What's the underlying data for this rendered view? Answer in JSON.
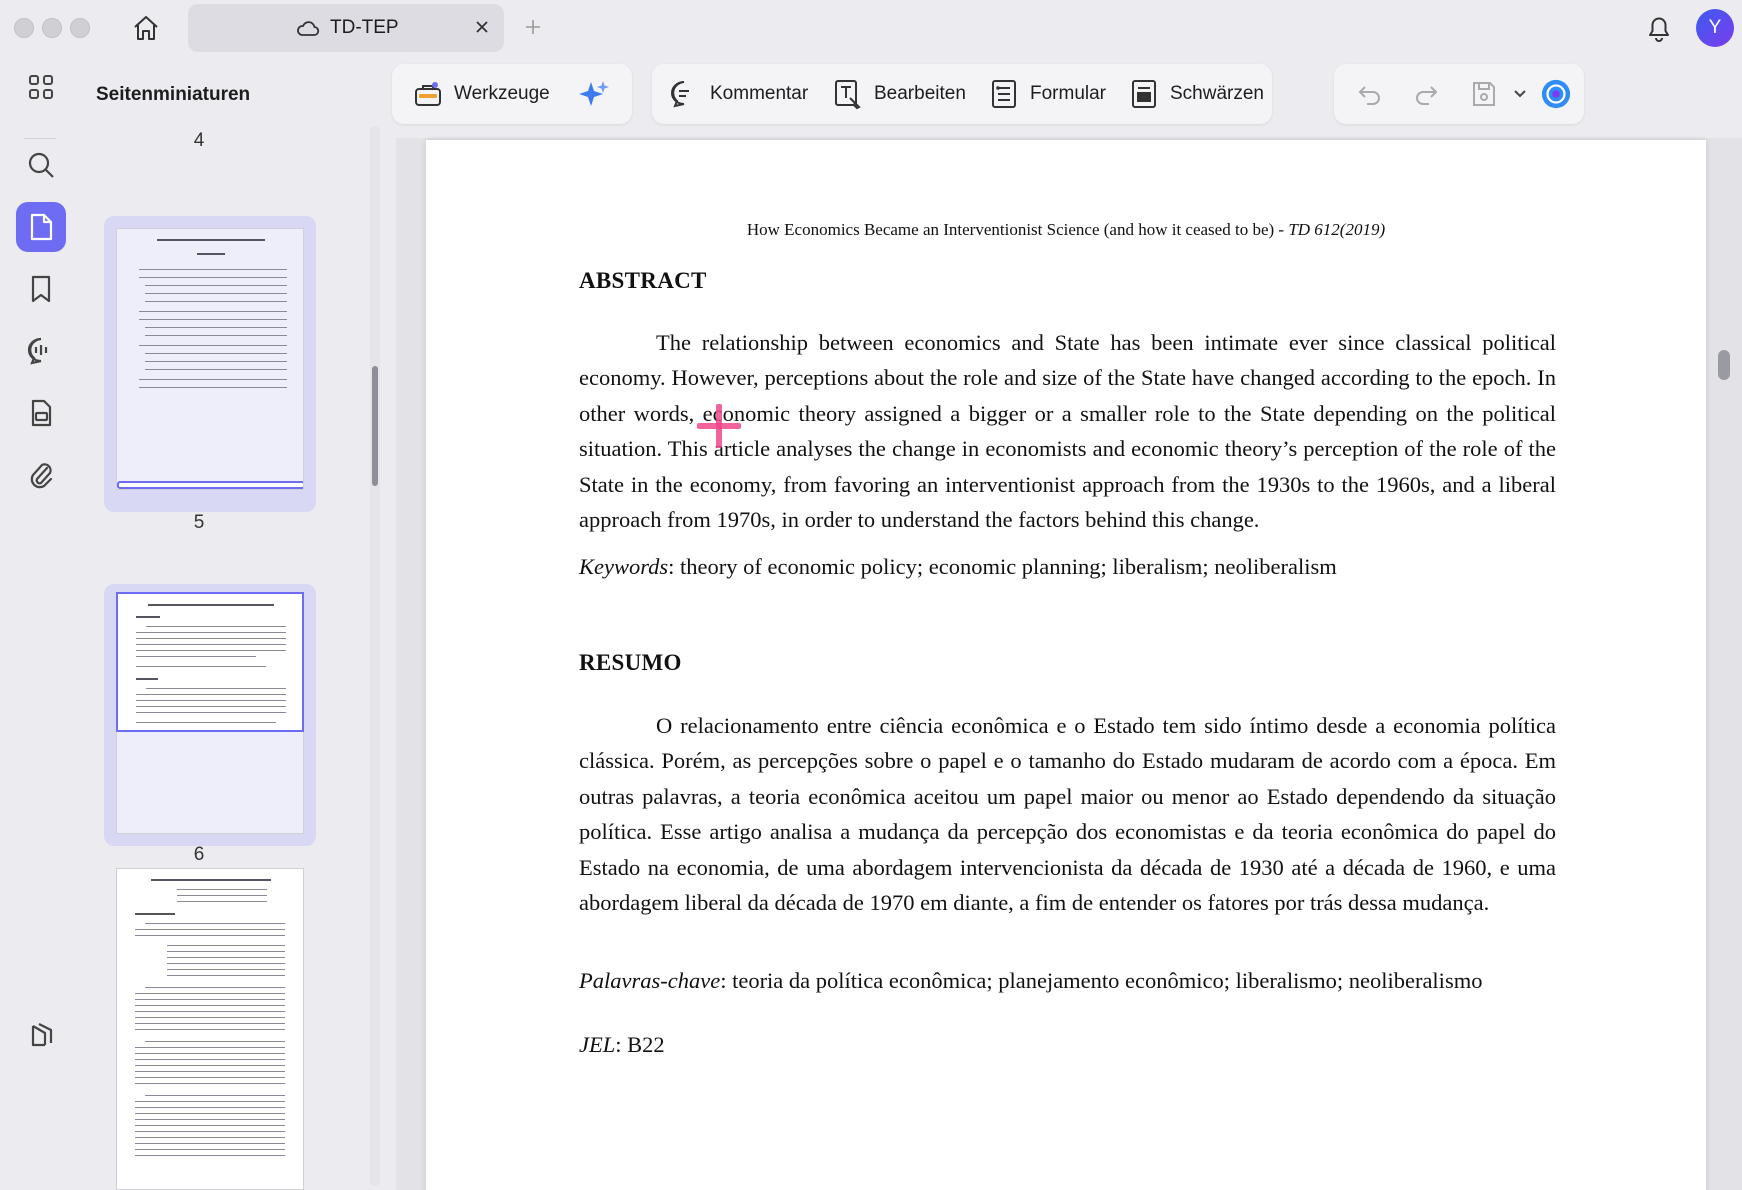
{
  "window": {
    "tab_title": "TD-TEP",
    "user_initial": "Y"
  },
  "sidebar": {
    "panel_title": "Seitenminiaturen",
    "page_numbers": [
      "4",
      "5",
      "6"
    ]
  },
  "toolbar": {
    "tools_label": "Werkzeuge",
    "comment_label": "Kommentar",
    "edit_label": "Bearbeiten",
    "form_label": "Formular",
    "redact_label": "Schwärzen"
  },
  "document": {
    "running_head": "How Economics Became an Interventionist Science (and how it ceased to be) - ",
    "running_head_italic": "TD 612(2019)",
    "abstract_heading": "ABSTRACT",
    "abstract_text": "The relationship between economics and State has been intimate ever since classical political economy. However, perceptions about the role and size of the State have changed according to the epoch. In other words, economic theory assigned a bigger or a smaller role to the State depending on the political situation. This article analyses the change in economists and economic theory’s perception of the role of the State in the economy, from favoring an interventionist approach from the 1930s to the 1960s, and a liberal approach from 1970s, in order to understand the factors behind this change.",
    "keywords_label": "Keywords",
    "keywords_text": ": theory of economic policy; economic planning; liberalism; neoliberalism",
    "resumo_heading": "RESUMO",
    "resumo_text": "O relacionamento entre ciência econômica e o Estado tem sido íntimo desde a economia política clássica. Porém, as percepções sobre o papel e o tamanho do Estado mudaram de acordo com a época. Em outras palavras, a teoria econômica aceitou um papel maior ou menor ao Estado dependendo da situação política. Esse artigo analisa a mudança da percepção dos economistas e da teoria econômica do papel do Estado na economia, de uma abordagem intervencionista da década de 1930 até a década de 1960, e uma abordagem liberal da década de 1970 em diante, a fim de entender os fatores por trás dessa mudança.",
    "palavras_label": "Palavras-chave",
    "palavras_text": ": teoria da política econômica; planejamento econômico; liberalismo; neoliberalismo",
    "jel_label": "JEL",
    "jel_text": ": B22"
  },
  "colors": {
    "accent": "#6e6cf2",
    "cursor": "#f0468c"
  }
}
